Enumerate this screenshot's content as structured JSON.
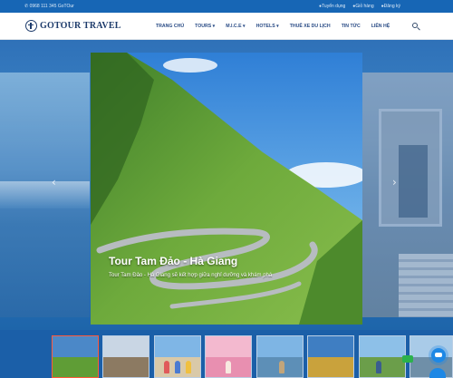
{
  "topbar": {
    "phone": "0968 111 345 GoTOur",
    "links": [
      "Tuyển dụng",
      "Giỏ hàng",
      "Đăng ký"
    ]
  },
  "brand": {
    "name": "GOTOUR TRAVEL"
  },
  "nav": {
    "items": [
      "TRANG CHỦ",
      "TOURS",
      "M.I.C.E",
      "HOTELS",
      "THUÊ XE DU LỊCH",
      "TIN TỨC",
      "LIÊN HỆ"
    ],
    "dropdown_caret": "▾"
  },
  "hero": {
    "title": "Tour Tam Đảo - Hà Giang",
    "description": "Tour Tam Đảo - Hà Giang sẽ kết hợp giữa nghỉ dưỡng và khám phá",
    "prev_arrow": "‹",
    "next_arrow": "›"
  },
  "thumbnails": {
    "count": 8,
    "active_index": 0
  },
  "colors": {
    "topbar_bg": "#1766b5",
    "nav_text": "#2a4c86",
    "brand_text": "#1d3b6b",
    "hero_bg": "#2b78bf",
    "active_thumb_border": "#ff5a3c",
    "messenger": "#1e88e5"
  },
  "icons": [
    "phone-icon",
    "user-icon",
    "cart-icon",
    "login-icon",
    "search-icon",
    "chevron-left-icon",
    "chevron-right-icon",
    "messenger-icon"
  ]
}
